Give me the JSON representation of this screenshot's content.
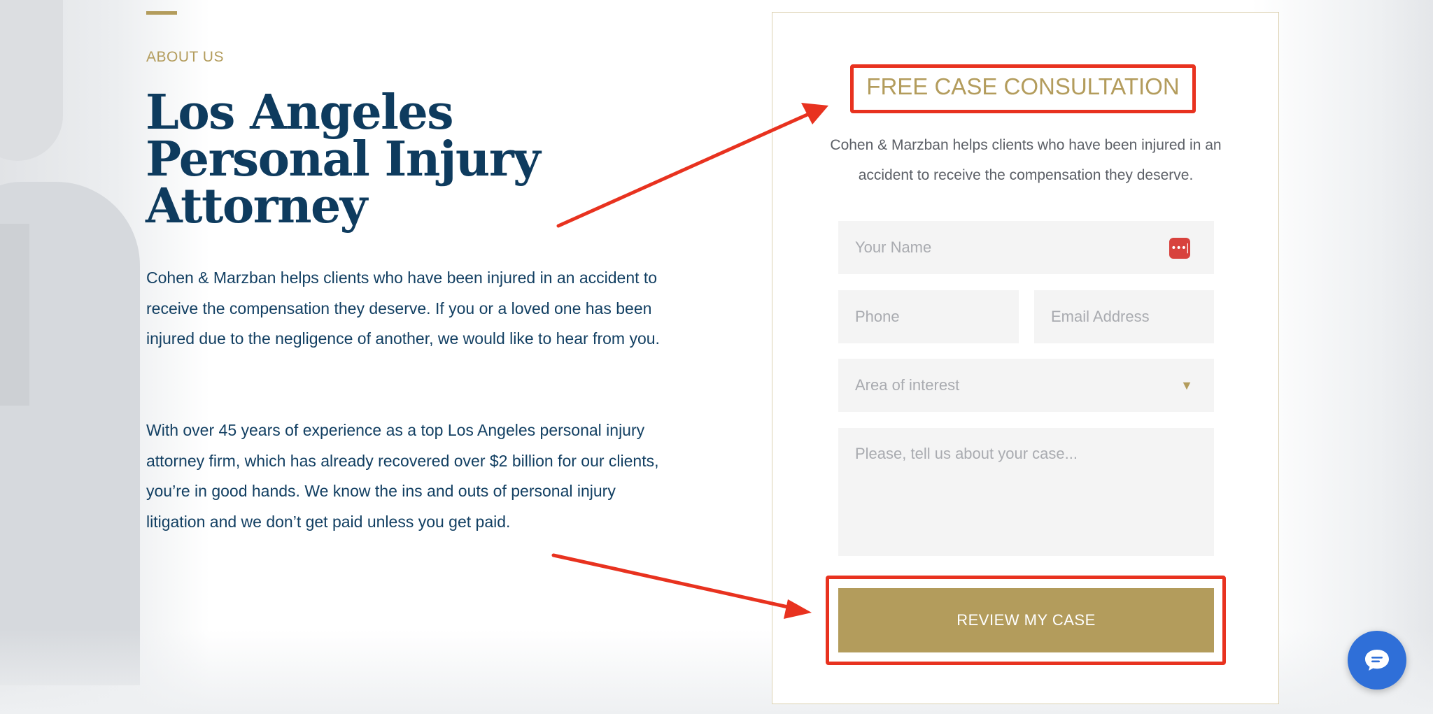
{
  "about": {
    "eyebrow": "ABOUT US",
    "title": "Los Angeles Personal Injury Attorney",
    "paragraphs": [
      "Cohen & Marzban helps clients who have been injured in an accident to receive the compensation they deserve. If you or a loved one has been injured due to the negligence of another, we would like to hear from you.",
      "With over 45 years of experience as a top Los Angeles personal injury attorney firm, which has already recovered over $2 billion for our clients, you’re in good hands. We know the ins and outs of personal injury litigation and we don’t get paid unless you get paid."
    ]
  },
  "form": {
    "title": "FREE CASE CONSULTATION",
    "subtitle": "Cohen & Marzban helps clients who have been injured in an accident to receive the compensation they deserve.",
    "name_placeholder": "Your Name",
    "phone_placeholder": "Phone",
    "email_placeholder": "Email Address",
    "area_placeholder": "Area of interest",
    "case_placeholder": "Please, tell us about your case...",
    "submit_label": "REVIEW MY CASE"
  },
  "icons": {
    "password_manager": "password-manager-icon",
    "dropdown": "caret-down-icon",
    "chat": "chat-icon"
  },
  "colors": {
    "gold": "#b39c5c",
    "navy": "#0e3b5e",
    "annotation_red": "#e8321f",
    "chat_blue": "#2f6fd8"
  }
}
